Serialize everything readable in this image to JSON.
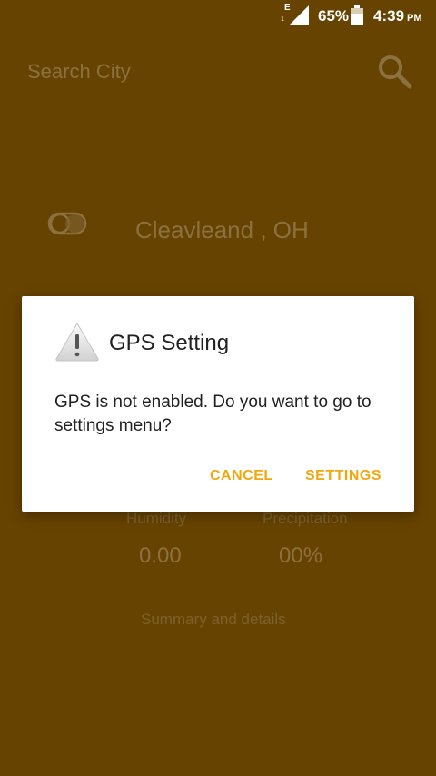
{
  "status_bar": {
    "network_type": "E",
    "sim_index": "1",
    "battery_percent": "65%",
    "time": "4:39",
    "ampm": "PM"
  },
  "app": {
    "search": {
      "placeholder": "Search City"
    },
    "location": "Cleavleand , OH",
    "humidity": {
      "label": "Humidity",
      "value": "0.00"
    },
    "precipitation": {
      "label": "Precipitation",
      "value": "00%"
    },
    "summary_link": "Summary and details"
  },
  "dialog": {
    "title": "GPS Setting",
    "message": "GPS is not enabled. Do you want to go to settings menu?",
    "cancel_label": "CANCEL",
    "settings_label": "SETTINGS"
  },
  "colors": {
    "background": "#674301",
    "accent": "#f0a80e",
    "dialog_text": "#212121"
  },
  "icons": {
    "search": "search-icon",
    "toggle": "toggle-icon",
    "warning": "warning-icon",
    "battery": "battery-icon",
    "signal": "signal-icon"
  }
}
